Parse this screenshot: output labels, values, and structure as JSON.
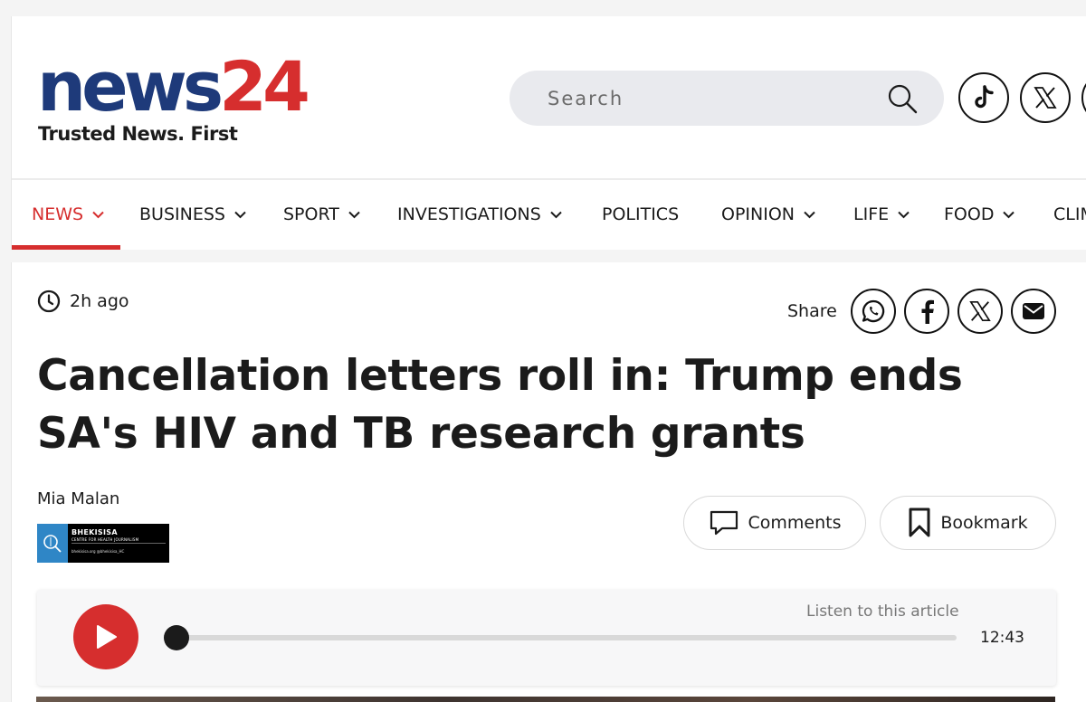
{
  "brand": {
    "logo_news": "news",
    "logo_24": "24",
    "tagline": "Trusted News. First",
    "colors": {
      "navy": "#1e3a7a",
      "red": "#d62e2e"
    }
  },
  "search": {
    "placeholder": "Search",
    "icon": "search-icon"
  },
  "social": [
    {
      "name": "TikTok",
      "icon": "tiktok-icon"
    },
    {
      "name": "X",
      "icon": "x-icon"
    }
  ],
  "nav": {
    "items": [
      {
        "label": "NEWS",
        "dropdown": true,
        "active": true
      },
      {
        "label": "BUSINESS",
        "dropdown": true
      },
      {
        "label": "SPORT",
        "dropdown": true
      },
      {
        "label": "INVESTIGATIONS",
        "dropdown": true
      },
      {
        "label": "POLITICS",
        "dropdown": false
      },
      {
        "label": "OPINION",
        "dropdown": true
      },
      {
        "label": "LIFE",
        "dropdown": true
      },
      {
        "label": "FOOD",
        "dropdown": true
      },
      {
        "label": "CLIM",
        "dropdown": false
      }
    ]
  },
  "article": {
    "time_ago": "2h ago",
    "share_label": "Share",
    "share_buttons": [
      "whatsapp-icon",
      "facebook-icon",
      "x-icon",
      "email-icon"
    ],
    "headline": "Cancellation letters roll in: Trump ends SA's HIV and TB research grants",
    "author": "Mia Malan",
    "partner": {
      "name": "BHEKISISA",
      "subtitle": "CENTRE FOR HEALTH JOURNALISM",
      "handles": "bhekisisa.org   @bhekisisa_HC"
    },
    "comments_label": "Comments",
    "bookmark_label": "Bookmark"
  },
  "audio": {
    "listen_label": "Listen to this article",
    "duration": "12:43",
    "progress": 0
  }
}
